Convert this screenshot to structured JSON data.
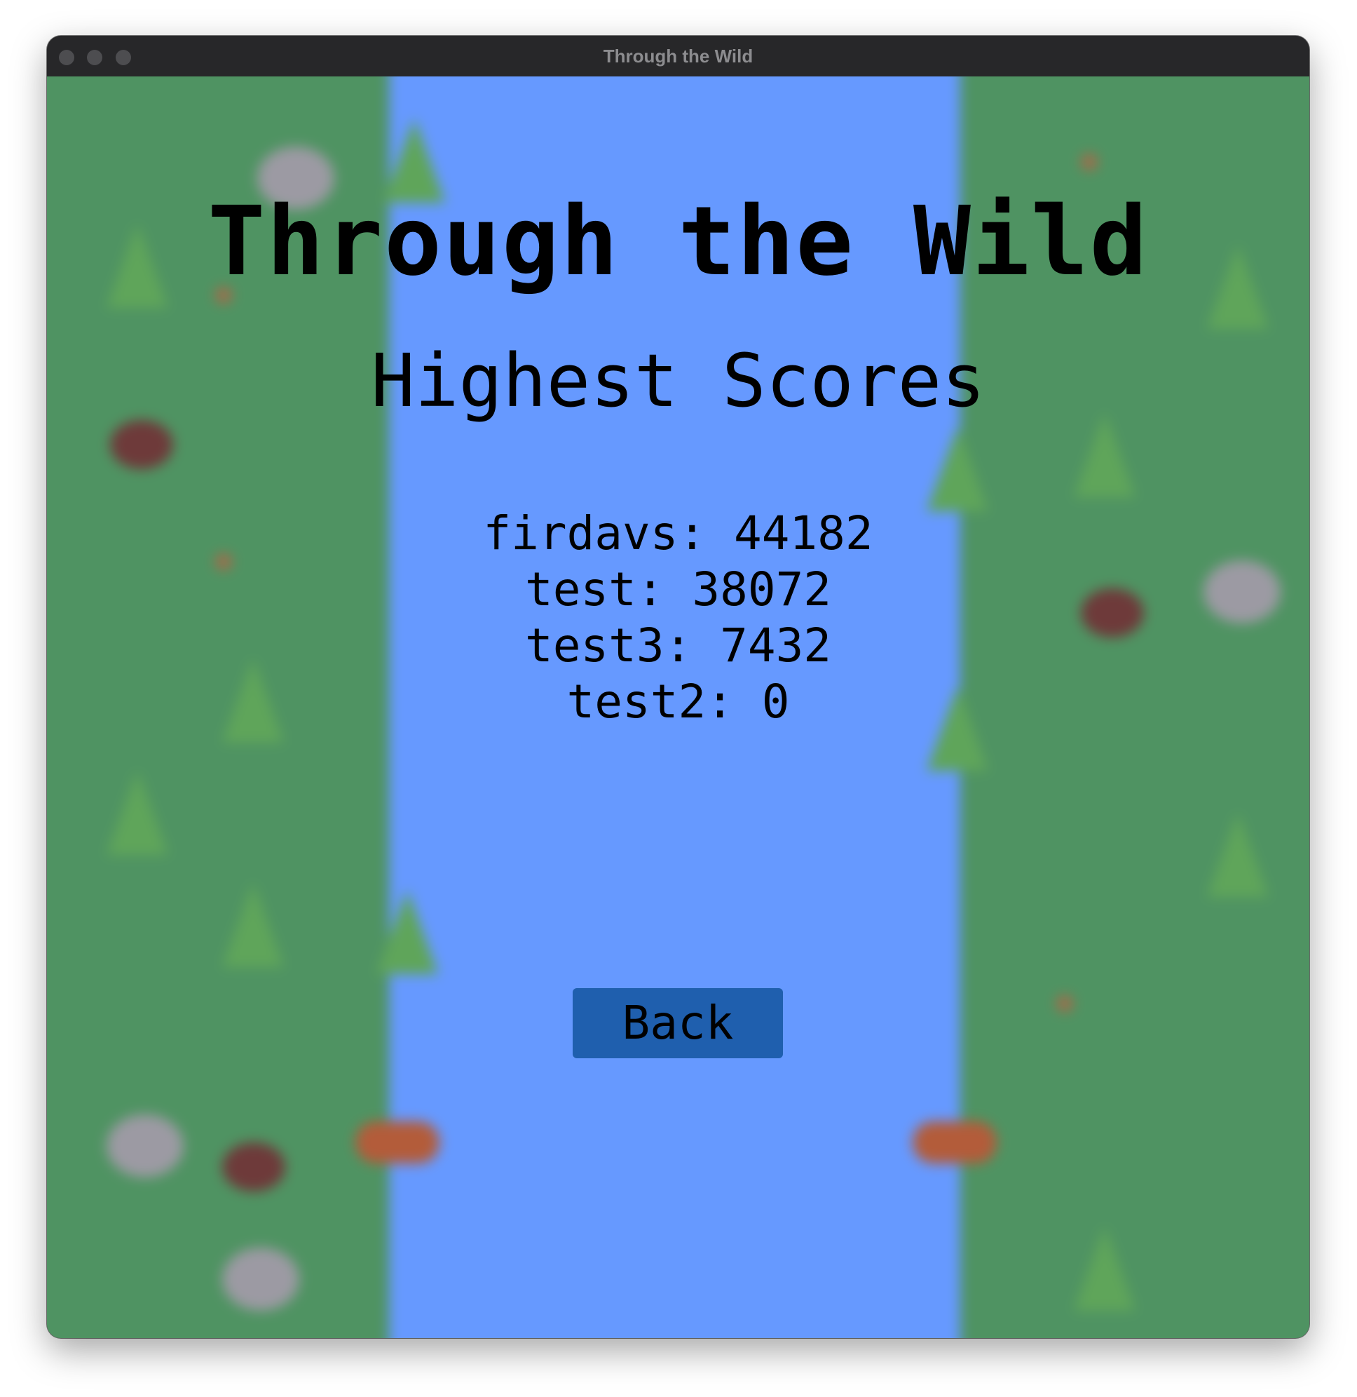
{
  "window": {
    "title": "Through the Wild"
  },
  "game": {
    "title": "Through the Wild",
    "screen_title": "Highest Scores",
    "scores": [
      {
        "text": "firdavs: 44182",
        "name": "firdavs",
        "score": 44182
      },
      {
        "text": "test: 38072",
        "name": "test",
        "score": 38072
      },
      {
        "text": "test3: 7432",
        "name": "test3",
        "score": 7432
      },
      {
        "text": "test2: 0",
        "name": "test2",
        "score": 0
      }
    ],
    "back_label": "Back"
  },
  "colors": {
    "grass": "#4f9362",
    "river": "#6699ff",
    "button": "#1f5fae",
    "text": "#000000"
  }
}
